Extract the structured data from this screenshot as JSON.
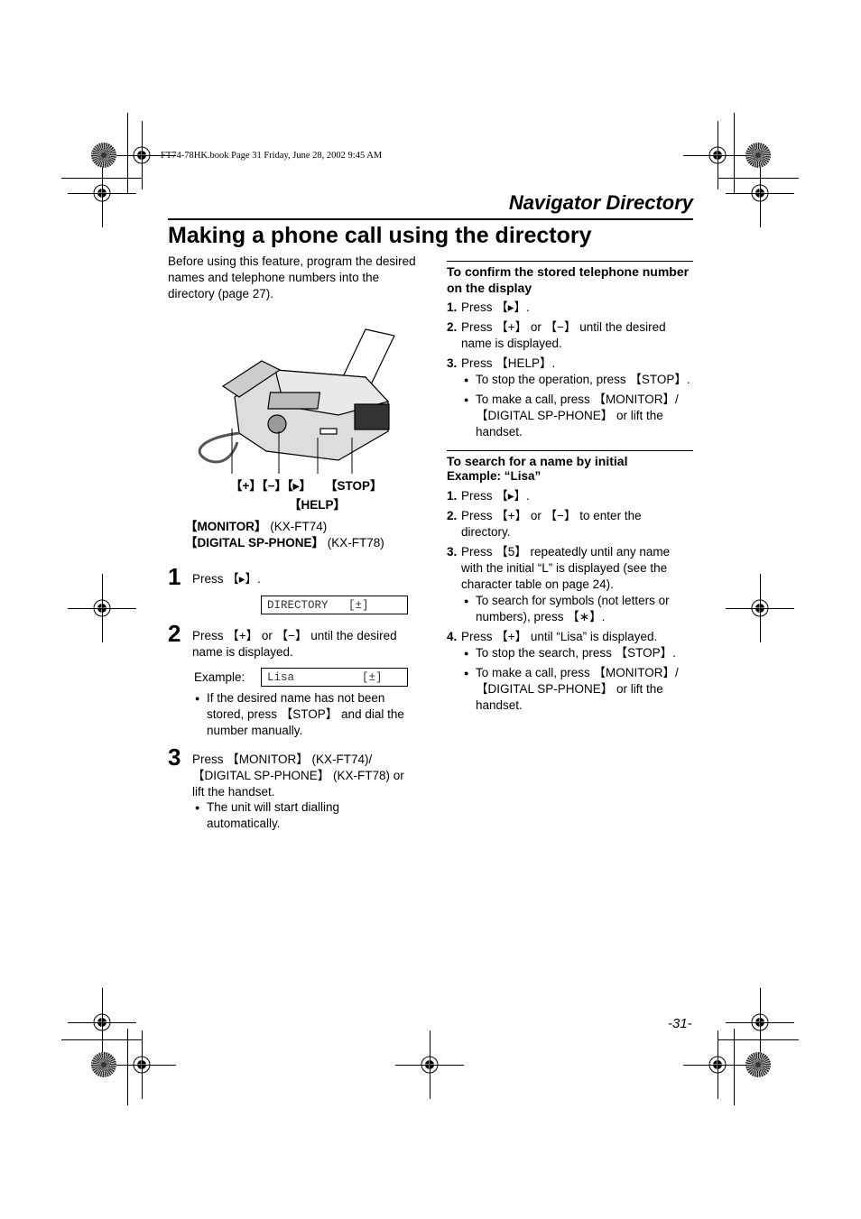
{
  "header": {
    "book_line": "FT74-78HK.book  Page 31  Friday, June 28, 2002  9:45 AM",
    "section_title": "Navigator Directory",
    "page_title": "Making a phone call using the directory"
  },
  "intro": "Before using this feature, program the desired names and telephone numbers into the directory (page 27).",
  "figure": {
    "callout_plus_minus_right": "【+】【−】【▸】",
    "callout_stop": "【STOP】",
    "callout_help": "【HELP】",
    "callout_monitor_key": "【MONITOR】",
    "callout_monitor_model": " (KX-FT74)",
    "callout_digital_key": "【DIGITAL SP-PHONE】",
    "callout_digital_model": " (KX-FT78)"
  },
  "steps": [
    {
      "num": "1",
      "text": "Press 【▸】.",
      "display": "DIRECTORY   [±]"
    },
    {
      "num": "2",
      "text": "Press 【+】 or 【−】 until the desired name is displayed.",
      "example_label": "Example:",
      "display": "Lisa          [±]",
      "bullets": [
        "If the desired name has not been stored, press 【STOP】 and dial the number manually."
      ]
    },
    {
      "num": "3",
      "text": "Press 【MONITOR】 (KX-FT74)/ 【DIGITAL SP-PHONE】 (KX-FT78) or lift the handset.",
      "bullets": [
        "The unit will start dialling automatically."
      ]
    }
  ],
  "confirm": {
    "title": "To confirm the stored telephone number on the display",
    "steps": [
      {
        "num": "1.",
        "text": "Press 【▸】."
      },
      {
        "num": "2.",
        "text": "Press 【+】 or 【−】 until the desired name is displayed."
      },
      {
        "num": "3.",
        "text": "Press 【HELP】.",
        "bullets": [
          "To stop the operation, press 【STOP】.",
          "To make a call, press 【MONITOR】/【DIGITAL SP-PHONE】 or lift the handset."
        ]
      }
    ]
  },
  "search": {
    "title": "To search for a name by initial",
    "subtitle": "Example: “Lisa”",
    "steps": [
      {
        "num": "1.",
        "text": "Press 【▸】."
      },
      {
        "num": "2.",
        "text": "Press 【+】 or 【−】 to enter the directory."
      },
      {
        "num": "3.",
        "text": "Press 【5】 repeatedly until any name with the initial “L” is displayed (see the character table on page 24).",
        "bullets": [
          "To search for symbols (not letters or numbers), press 【∗】."
        ]
      },
      {
        "num": "4.",
        "text": "Press 【+】 until “Lisa” is displayed.",
        "bullets": [
          "To stop the search, press 【STOP】.",
          "To make a call, press 【MONITOR】/【DIGITAL SP-PHONE】 or lift the handset."
        ]
      }
    ]
  },
  "footer": {
    "page_number": "-31-"
  }
}
